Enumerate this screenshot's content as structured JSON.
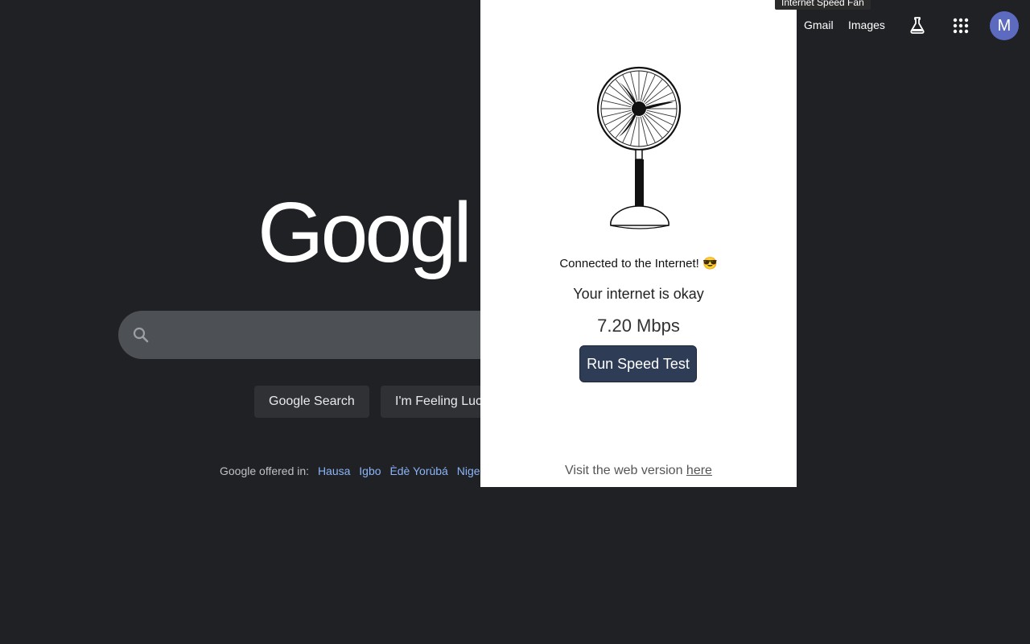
{
  "header": {
    "gmail_label": "Gmail",
    "images_label": "Images",
    "avatar_letter": "M",
    "labs_icon": "flask-icon",
    "apps_icon": "apps-grid-icon"
  },
  "logo": {
    "text": "Googl"
  },
  "search": {
    "placeholder": "",
    "value": ""
  },
  "buttons": {
    "search_label": "Google Search",
    "lucky_label": "I'm Feeling Lucky"
  },
  "offered": {
    "prefix": "Google offered in:",
    "languages": [
      "Hausa",
      "Igbo",
      "Èdè Yorùbá",
      "Nigerian Pidgin"
    ]
  },
  "extension": {
    "tooltip": "Internet Speed Fan",
    "status": "Connected to the Internet! 😎",
    "verdict": "Your internet is okay",
    "speed": "7.20 Mbps",
    "run_button": "Run Speed Test",
    "footer_prefix": "Visit the web version ",
    "footer_link": "here",
    "fan_icon": "fan-icon"
  },
  "colors": {
    "page_bg": "#202124",
    "searchbox_bg": "#4d5156",
    "link": "#8ab4f8",
    "run_button_bg": "#2e3d55",
    "avatar_bg": "#5c6bc0"
  }
}
